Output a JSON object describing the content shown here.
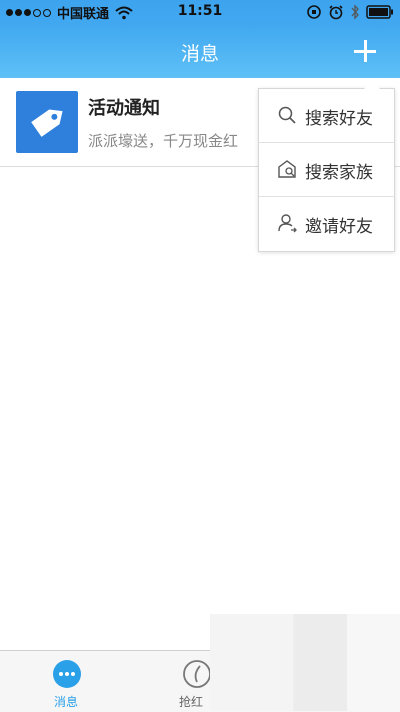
{
  "status_bar": {
    "carrier": "中国联通",
    "time": "11:51"
  },
  "nav": {
    "title": "消息"
  },
  "conversations": [
    {
      "title": "活动通知",
      "preview": "派派壕送，千万现金红"
    }
  ],
  "popup_menu": {
    "items": [
      {
        "label": "搜索好友",
        "icon": "search-icon"
      },
      {
        "label": "搜索家族",
        "icon": "family-house-icon"
      },
      {
        "label": "邀请好友",
        "icon": "invite-user-icon"
      }
    ]
  },
  "tabs": [
    {
      "label": "消息",
      "icon": "chat-bubble-icon",
      "active": true
    },
    {
      "label": "抢红",
      "icon": "at-envelope-icon",
      "active": false
    }
  ],
  "colors": {
    "accent": "#2aa0e8",
    "header": "#41a8f0",
    "avatar": "#2f7fdc"
  }
}
